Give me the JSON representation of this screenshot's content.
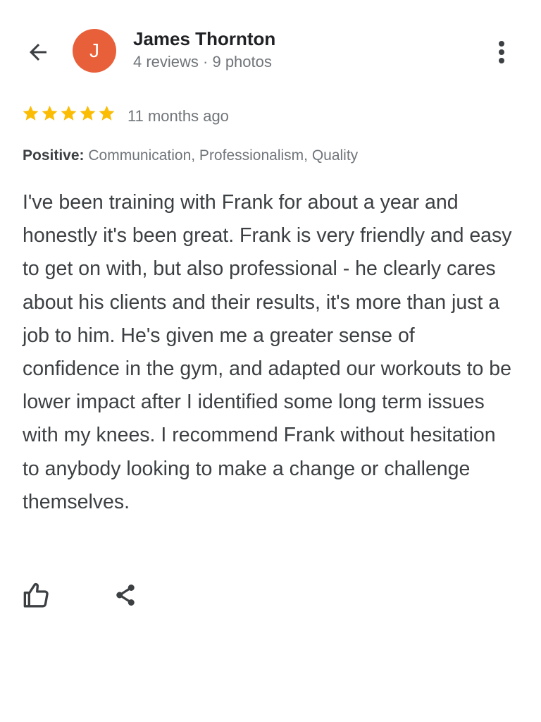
{
  "header": {
    "back_icon": "arrow-back-icon",
    "avatar_initial": "J",
    "avatar_color": "#e8603a",
    "reviewer_name": "James Thornton",
    "reviewer_meta": "4 reviews · 9 photos",
    "more_icon": "more-vert-icon"
  },
  "review": {
    "rating": 5,
    "rating_max": 5,
    "star_color": "#fbbc04",
    "time_ago": "11 months ago",
    "positive_label": "Positive:",
    "positive_values": "Communication, Professionalism, Quality",
    "text": "I've been training with Frank for about a year and honestly it's been great. Frank is very friendly and easy to get on with, but also professional - he clearly cares about his clients and their results, it's more than just a job to him. He's given me a greater sense of confidence in the gym, and adapted our workouts to be lower impact after I identified some long term issues with my knees. I recommend Frank without hesitation to anybody looking to make a change or challenge themselves."
  },
  "actions": {
    "like_icon": "thumb-up-icon",
    "share_icon": "share-icon"
  }
}
